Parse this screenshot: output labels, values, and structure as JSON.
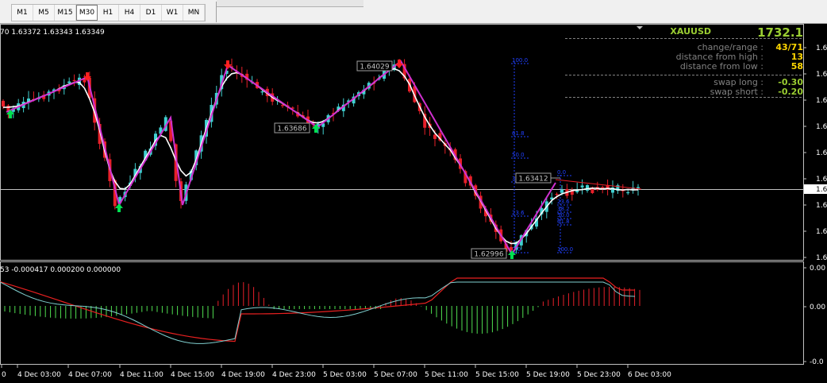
{
  "toolbar": {
    "timeframes": [
      {
        "label": "M1",
        "active": false
      },
      {
        "label": "M5",
        "active": false
      },
      {
        "label": "M15",
        "active": false
      },
      {
        "label": "M30",
        "active": true
      },
      {
        "label": "H1",
        "active": false
      },
      {
        "label": "H4",
        "active": false
      },
      {
        "label": "D1",
        "active": false
      },
      {
        "label": "W1",
        "active": false
      },
      {
        "label": "MN",
        "active": false
      }
    ]
  },
  "price_header": "70 1.63372 1.63343 1.63349",
  "indicator_header": "53 -0.000417 0.000200 0.000000",
  "info_panel": {
    "symbol": "XAUUSD",
    "price": "1732.1",
    "rows": [
      {
        "label": "change/range :",
        "value": "43/71",
        "color": "#ffd700"
      },
      {
        "label": "distance from high :",
        "value": "13",
        "color": "#ffd700"
      },
      {
        "label": "distance from low :",
        "value": "58",
        "color": "#ffd700"
      },
      {
        "label": "swap long :",
        "value": "-0.30",
        "color": "#9acd32"
      },
      {
        "label": "swap short :",
        "value": "-0.20",
        "color": "#9acd32"
      }
    ]
  },
  "price_labels": [
    {
      "text": "1.64029",
      "series": "high"
    },
    {
      "text": "1.63686",
      "series": "low"
    },
    {
      "text": "1.63412",
      "series": "current"
    },
    {
      "text": "1.62996",
      "series": "low"
    }
  ],
  "fib_left": [
    "100.0",
    "61.8",
    "50.0",
    "38.2",
    "23.6",
    "0.0"
  ],
  "fib_right": [
    "0.0",
    "23.6",
    "38.2",
    "50.0",
    "61.8",
    "100.0"
  ],
  "price_axis_labels": [
    "1.6",
    "1.6",
    "1.6",
    "1.6",
    "1.6",
    "1.6",
    "1.6",
    "1.6",
    "1.6"
  ],
  "current_price_tag": "1.6",
  "indicator_axis_labels": [
    "0.00",
    "0.00",
    "-0.0"
  ],
  "time_labels": [
    "0",
    "4 Dec 03:00",
    "4 Dec 07:00",
    "4 Dec 11:00",
    "4 Dec 15:00",
    "4 Dec 19:00",
    "4 Dec 23:00",
    "5 Dec 03:00",
    "5 Dec 07:00",
    "5 Dec 11:00",
    "5 Dec 15:00",
    "5 Dec 19:00",
    "5 Dec 23:00",
    "6 Dec 03:00"
  ],
  "colors": {
    "bull_candle": "#40d0d0",
    "bear_candle": "#e8202a",
    "zigzag": "#d030d0",
    "ma_line": "#ffffff",
    "up_arrow": "#00e050",
    "down_arrow": "#ff2020",
    "fib": "#2040ff",
    "osc_pos": "#e8202a",
    "osc_neg": "#50e050",
    "signal_red": "#e82020",
    "signal_cyan": "#80d0d0"
  }
}
